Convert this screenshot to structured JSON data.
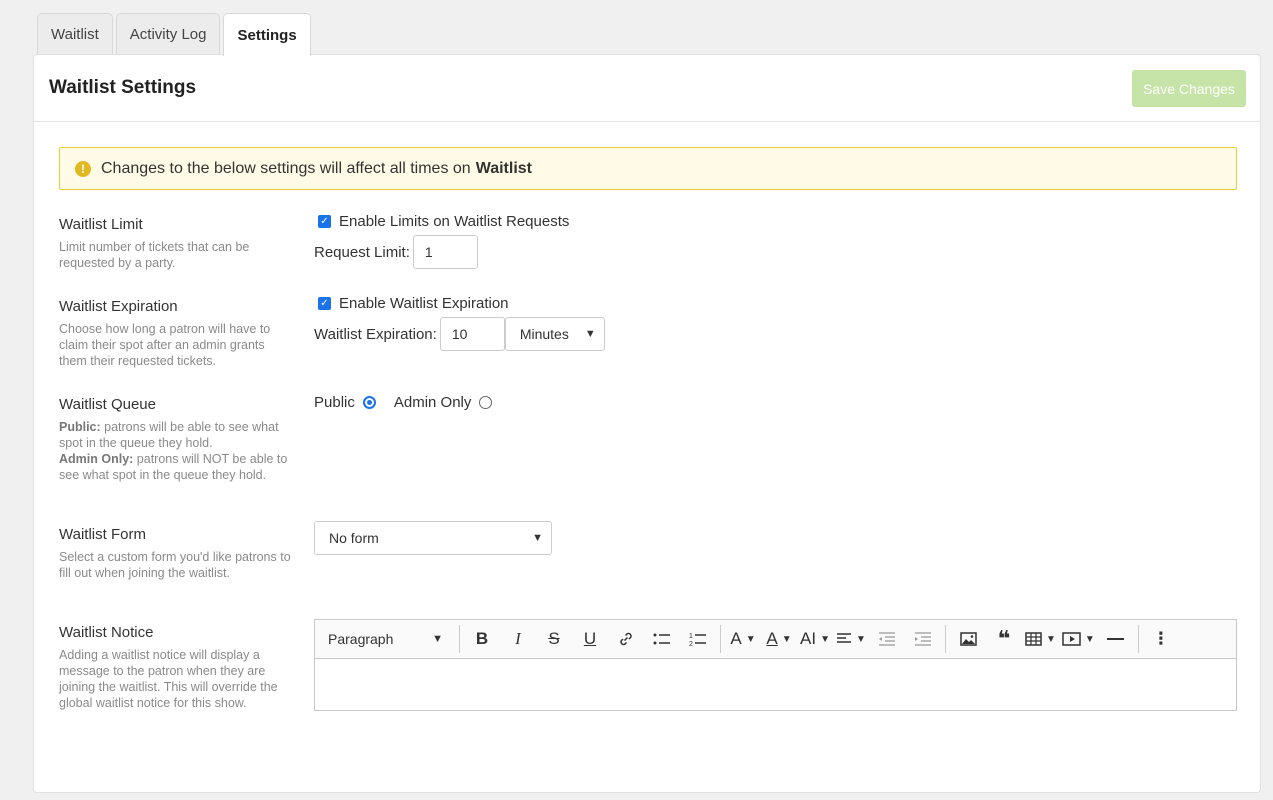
{
  "tabs": [
    {
      "label": "Waitlist",
      "active": false
    },
    {
      "label": "Activity Log",
      "active": false
    },
    {
      "label": "Settings",
      "active": true
    }
  ],
  "panel": {
    "title": "Waitlist Settings",
    "save_label": "Save Changes"
  },
  "alert": {
    "text": "Changes to the below settings will affect all times on",
    "emphasis": "Waitlist",
    "icon": "exclamation-icon"
  },
  "limit": {
    "title": "Waitlist Limit",
    "desc": "Limit number of tickets that can be requested by a party.",
    "checkbox_label": "Enable Limits on Waitlist Requests",
    "checked": true,
    "field_label": "Request Limit:",
    "value": "1"
  },
  "expiration": {
    "title": "Waitlist Expiration",
    "desc": "Choose how long a patron will have to claim their spot after an admin grants them their requested tickets.",
    "checkbox_label": "Enable Waitlist Expiration",
    "checked": true,
    "field_label": "Waitlist Expiration:",
    "value": "10",
    "unit": "Minutes"
  },
  "queue": {
    "title": "Waitlist Queue",
    "public_bold": "Public:",
    "public_desc": " patrons will be able to see what spot in the queue they hold.",
    "admin_bold": "Admin Only:",
    "admin_desc": " patrons will NOT be able to see what spot in the queue they hold.",
    "option_public": "Public",
    "option_admin": "Admin Only",
    "selected": "Public"
  },
  "form": {
    "title": "Waitlist Form",
    "desc": "Select a custom form you'd like patrons to fill out when joining the waitlist.",
    "selected": "No form"
  },
  "notice": {
    "title": "Waitlist Notice",
    "desc": "Adding a waitlist notice will display a message to the patron when they are joining the waitlist. This will override the global waitlist notice for this show.",
    "paragraph_style": "Paragraph"
  },
  "colors": {
    "accent": "#1a73e8",
    "save_disabled": "#c6e4a7",
    "alert_bg": "#fffbe6",
    "alert_border": "#e4cf3a"
  }
}
